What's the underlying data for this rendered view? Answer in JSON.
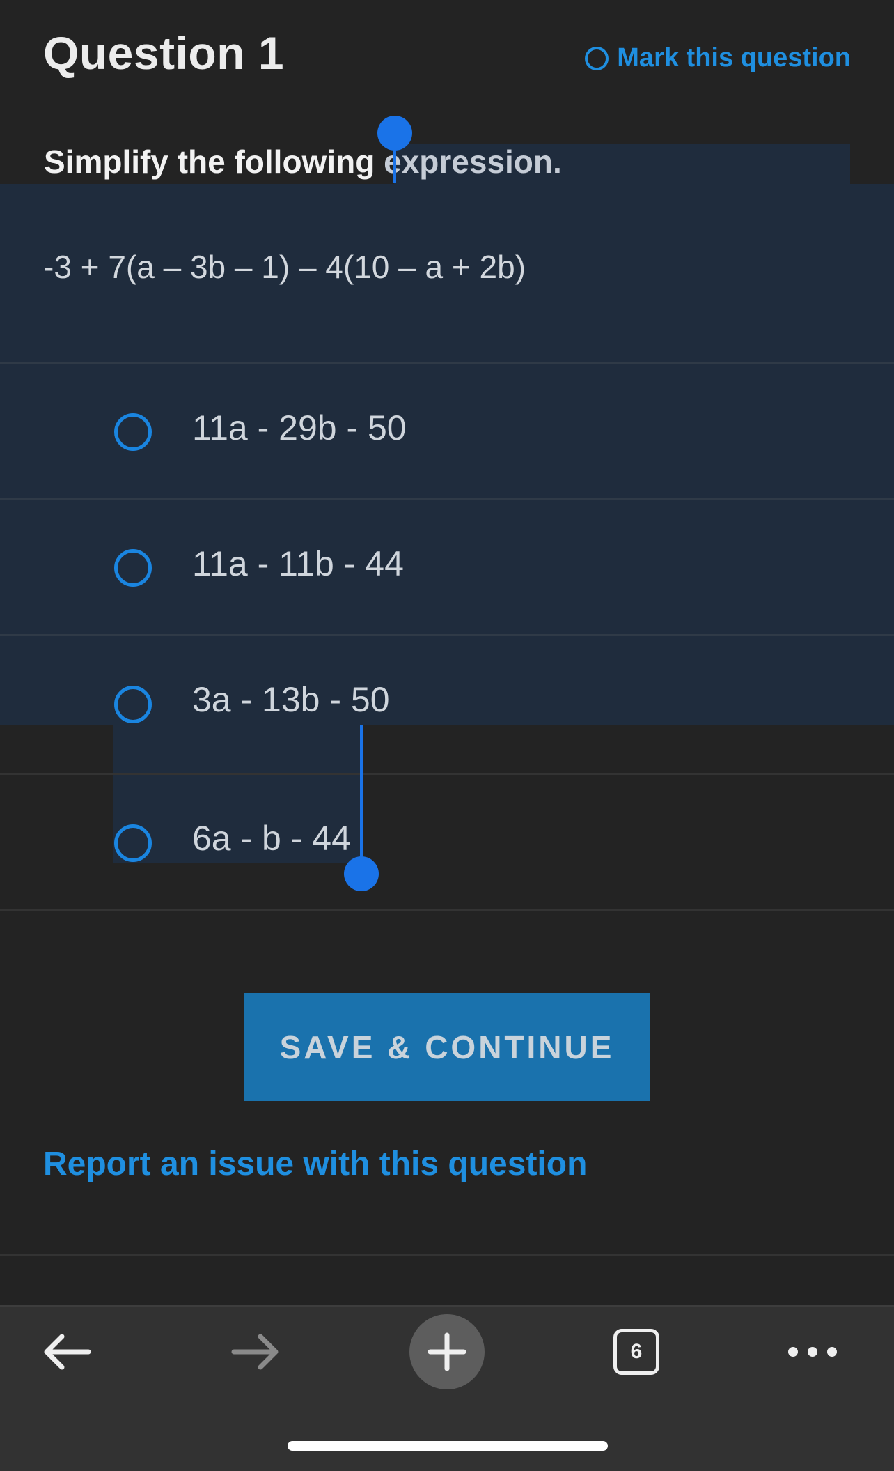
{
  "header": {
    "title": "Question 1",
    "mark_label": "Mark this question"
  },
  "question": {
    "prompt_before": "Simplify the following ",
    "prompt_selected": "expression.",
    "expression": "-3 + 7(a – 3b – 1) – 4(10 – a + 2b)"
  },
  "options": [
    {
      "label": "11a - 29b - 50"
    },
    {
      "label": "11a - 11b - 44"
    },
    {
      "label": "3a - 13b - 50"
    },
    {
      "label": "6a - b - 44"
    }
  ],
  "actions": {
    "save_label": "SAVE & CONTINUE",
    "report_label": "Report an issue with this question"
  },
  "browser": {
    "tab_count": "6",
    "icons": [
      "back-arrow-icon",
      "forward-arrow-icon",
      "new-tab-plus-icon",
      "tabs-icon",
      "more-icon"
    ]
  },
  "colors": {
    "accent": "#1f8fe0",
    "button_bg": "#1a72ad",
    "selection_bg": "#1f2c3d",
    "selection_handle": "#1a73e8",
    "page_bg": "#232323"
  }
}
